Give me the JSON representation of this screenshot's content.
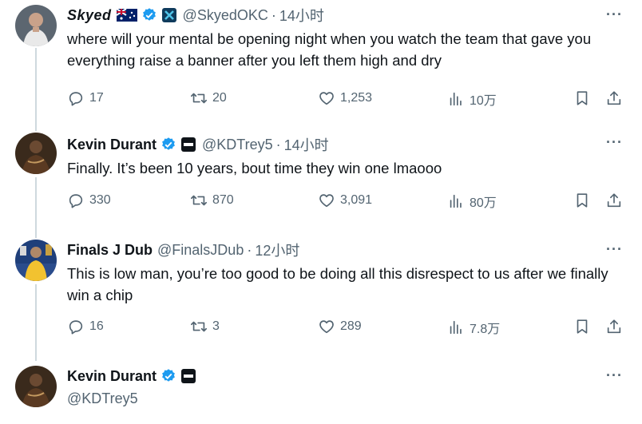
{
  "tweets": [
    {
      "name": "Skyed",
      "handle": "@SkyedOKC",
      "time": "14小时",
      "text": "where will your mental be opening night when you watch the team that gave you everything raise a banner after you left them high and dry",
      "replies": "17",
      "retweets": "20",
      "likes": "1,253",
      "views": "10万",
      "more": "···"
    },
    {
      "name": "Kevin Durant",
      "handle": "@KDTrey5",
      "time": "14小时",
      "text": "Finally. It’s been 10 years, bout time they win one lmaooo",
      "replies": "330",
      "retweets": "870",
      "likes": "3,091",
      "views": "80万",
      "more": "···"
    },
    {
      "name": "Finals J Dub",
      "handle": "@FinalsJDub",
      "time": "12小时",
      "text": "This is low man, you’re too good to be doing all this disrespect to us after we finally win a chip",
      "replies": "16",
      "retweets": "3",
      "likes": "289",
      "views": "7.8万",
      "more": "···"
    },
    {
      "name": "Kevin Durant",
      "handle": "@KDTrey5",
      "more": "···"
    }
  ],
  "colors": {
    "verified": "#1d9bf0",
    "thread_line": "#cfd9de",
    "secondary_text": "#536471"
  }
}
